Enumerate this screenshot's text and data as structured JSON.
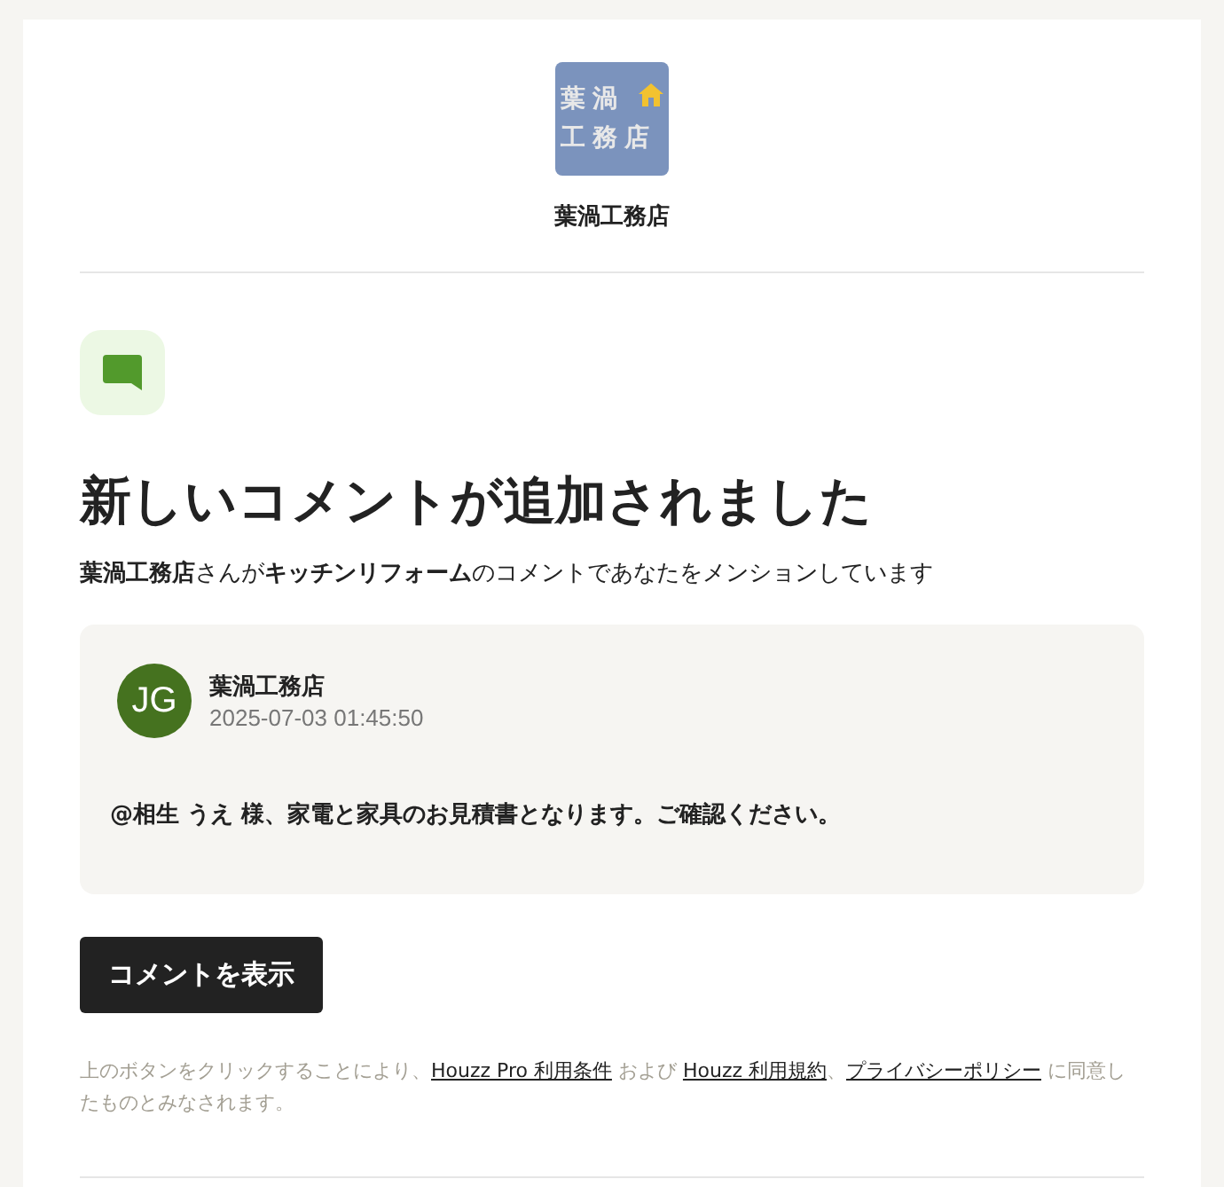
{
  "logo": {
    "lines": [
      "葉渦",
      "工務店"
    ]
  },
  "brand_name": "葉渦工務店",
  "heading": "新しいコメントが追加されました",
  "summary": "**葉渦工務店**さんが**キッチンリフォーム**のコメントであなたをメンションしています",
  "comment": {
    "initials": "JG",
    "author": "葉渦工務店",
    "timestamp": "2025-07-03 01:45:50",
    "text": "@相生 うえ 様、家電と家具のお見積書となります。ご確認ください。"
  },
  "button": "コメントを表示",
  "disclaimer": [
    {
      "kind": "text",
      "text": "上のボタンをクリックすることにより、"
    },
    {
      "kind": "link",
      "text": "Houzz Pro 利用条件"
    },
    {
      "kind": "text",
      "text": " および "
    },
    {
      "kind": "link",
      "text": "Houzz 利用規約"
    },
    {
      "kind": "text",
      "text": "、"
    },
    {
      "kind": "link",
      "text": "プライバシーポリシー"
    },
    {
      "kind": "text",
      "text": " に同意したものとみなされます。"
    }
  ]
}
